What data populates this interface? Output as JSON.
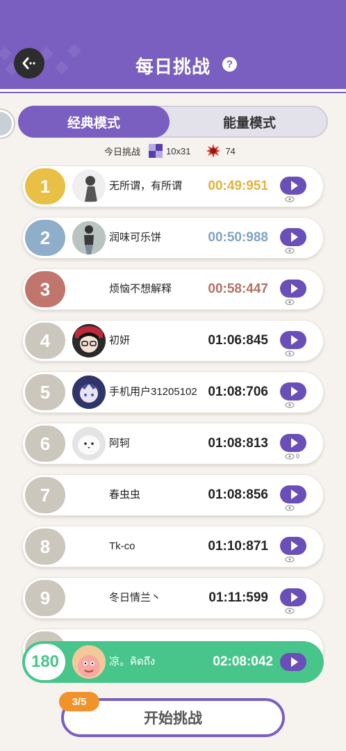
{
  "header": {
    "title": "每日挑战",
    "help": "?"
  },
  "tabs": [
    {
      "label": "经典模式",
      "active": true
    },
    {
      "label": "能量模式",
      "active": false
    }
  ],
  "challenge": {
    "label": "今日挑战",
    "size": "10x31",
    "count": "74"
  },
  "colors": {
    "accent": "#7a5fc0",
    "gold": "#e9c046",
    "silver": "#8faec9",
    "bronze": "#c0766c",
    "rank_default": "#cbc7bd",
    "me": "#48c58b"
  },
  "leaderboard": [
    {
      "rank": "1",
      "name": "无所谓，有所谓",
      "time": "00:49:951",
      "time_color": "#e3b33a"
    },
    {
      "rank": "2",
      "name": "润味可乐饼",
      "time": "00:50:988",
      "time_color": "#7fa3c1"
    },
    {
      "rank": "3",
      "name": "烦恼不想解释",
      "time": "00:58:447",
      "time_color": "#b27266"
    },
    {
      "rank": "4",
      "name": "初妍",
      "time": "01:06:845"
    },
    {
      "rank": "5",
      "name": "手机用户31205102",
      "time": "01:08:706"
    },
    {
      "rank": "6",
      "name": "阿轲",
      "time": "01:08:813",
      "views": "0"
    },
    {
      "rank": "7",
      "name": "春虫虫",
      "time": "01:08:856"
    },
    {
      "rank": "8",
      "name": "Tk-co",
      "time": "01:10:871"
    },
    {
      "rank": "9",
      "name": "冬日情兰丶",
      "time": "01:11:599"
    }
  ],
  "me": {
    "rank": "180",
    "name": "凉。คิดถึง",
    "time": "02:08:042"
  },
  "start": {
    "label": "开始挑战",
    "attempts": "3/5"
  }
}
